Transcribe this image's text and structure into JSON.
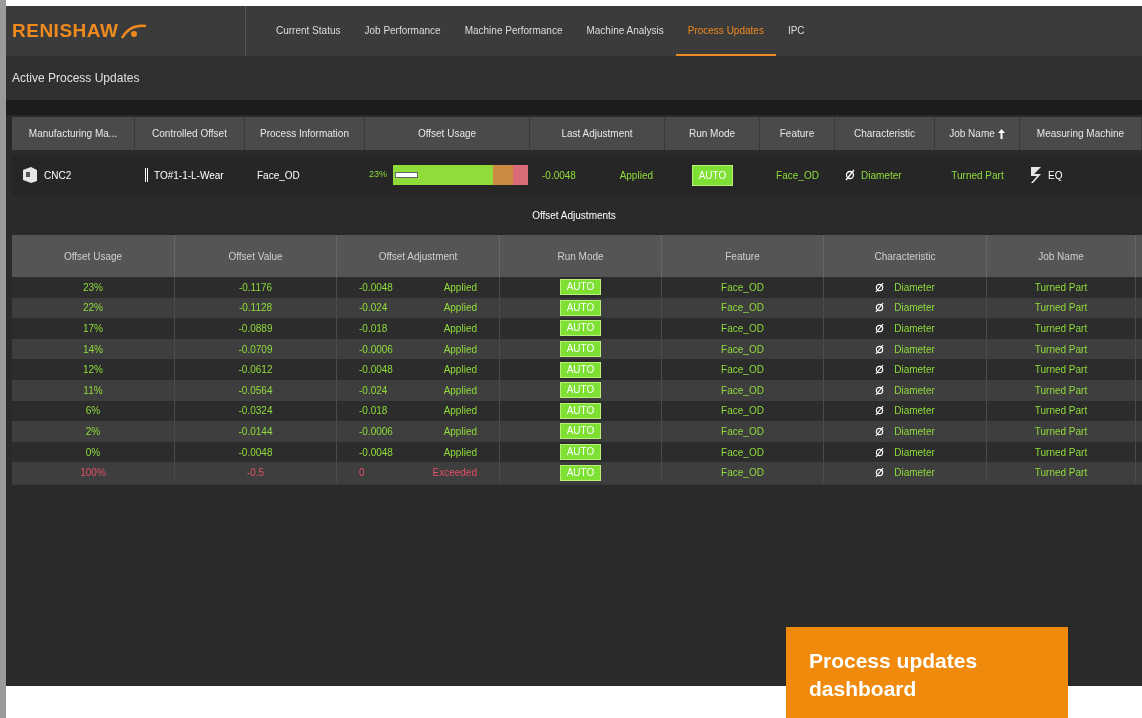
{
  "brand": {
    "logo": "RENISHAW"
  },
  "nav": [
    {
      "label": "Current Status",
      "selected": false
    },
    {
      "label": "Job Performance",
      "selected": false
    },
    {
      "label": "Machine Performance",
      "selected": false
    },
    {
      "label": "Machine Analysis",
      "selected": false
    },
    {
      "label": "Process Updates",
      "selected": true
    },
    {
      "label": "IPC",
      "selected": false
    }
  ],
  "page_title": "Active Process Updates",
  "main_table": {
    "columns": [
      "Manufacturing Ma...",
      "Controlled Offset",
      "Process Information",
      "Offset Usage",
      "Last Adjustment",
      "Run Mode",
      "Feature",
      "Characteristic",
      "Job Name",
      "Measuring Machine"
    ],
    "rows": [
      {
        "machine": "CNC2",
        "offset": "TO#1-1-L-Wear",
        "process": "Face_OD",
        "usage": "23%",
        "level": 0.23,
        "adjustment": "-0.0048",
        "status": "Applied",
        "run_mode": "AUTO",
        "feature": "Face_OD",
        "characteristic": "Diameter",
        "job": "Turned Part",
        "measuring_machine": "EQ"
      }
    ]
  },
  "section_title": "Offset Adjustments",
  "adjustments": {
    "columns": [
      "Offset Usage",
      "Offset Value",
      "Offset Adjustment",
      "Run Mode",
      "Feature",
      "Characteristic",
      "Job Name"
    ],
    "rows": [
      {
        "kind": "ok",
        "usage": "23%",
        "value": "-0.1176",
        "adjustment": "-0.0048",
        "status": "Applied",
        "run_mode": "AUTO",
        "feature": "Face_OD",
        "characteristic": "Diameter",
        "job": "Turned Part"
      },
      {
        "kind": "ok",
        "usage": "22%",
        "value": "-0.1128",
        "adjustment": "-0.024",
        "status": "Applied",
        "run_mode": "AUTO",
        "feature": "Face_OD",
        "characteristic": "Diameter",
        "job": "Turned Part"
      },
      {
        "kind": "ok",
        "usage": "17%",
        "value": "-0.0889",
        "adjustment": "-0.018",
        "status": "Applied",
        "run_mode": "AUTO",
        "feature": "Face_OD",
        "characteristic": "Diameter",
        "job": "Turned Part"
      },
      {
        "kind": "ok",
        "usage": "14%",
        "value": "-0.0709",
        "adjustment": "-0.0006",
        "status": "Applied",
        "run_mode": "AUTO",
        "feature": "Face_OD",
        "characteristic": "Diameter",
        "job": "Turned Part"
      },
      {
        "kind": "ok",
        "usage": "12%",
        "value": "-0.0612",
        "adjustment": "-0.0048",
        "status": "Applied",
        "run_mode": "AUTO",
        "feature": "Face_OD",
        "characteristic": "Diameter",
        "job": "Turned Part"
      },
      {
        "kind": "ok",
        "usage": "11%",
        "value": "-0.0564",
        "adjustment": "-0.024",
        "status": "Applied",
        "run_mode": "AUTO",
        "feature": "Face_OD",
        "characteristic": "Diameter",
        "job": "Turned Part"
      },
      {
        "kind": "ok",
        "usage": "6%",
        "value": "-0.0324",
        "adjustment": "-0.018",
        "status": "Applied",
        "run_mode": "AUTO",
        "feature": "Face_OD",
        "characteristic": "Diameter",
        "job": "Turned Part"
      },
      {
        "kind": "ok",
        "usage": "2%",
        "value": "-0.0144",
        "adjustment": "-0.0006",
        "status": "Applied",
        "run_mode": "AUTO",
        "feature": "Face_OD",
        "characteristic": "Diameter",
        "job": "Turned Part"
      },
      {
        "kind": "ok",
        "usage": "0%",
        "value": "-0.0048",
        "adjustment": "-0.0048",
        "status": "Applied",
        "run_mode": "AUTO",
        "feature": "Face_OD",
        "characteristic": "Diameter",
        "job": "Turned Part"
      },
      {
        "kind": "alert",
        "usage": "100%",
        "value": "-0.5",
        "adjustment": "0",
        "status": "Exceeded",
        "run_mode": "AUTO",
        "feature": "Face_OD",
        "characteristic": "Diameter",
        "job": "Turned Part"
      }
    ]
  },
  "caption": "Process updates dashboard"
}
